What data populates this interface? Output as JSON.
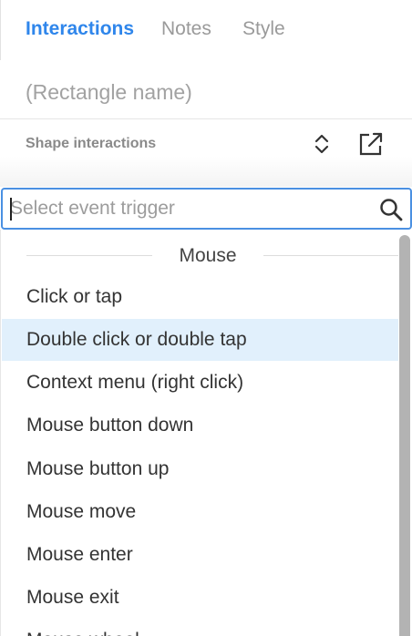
{
  "tabs": [
    {
      "label": "Interactions",
      "active": true
    },
    {
      "label": "Notes",
      "active": false
    },
    {
      "label": "Style",
      "active": false
    }
  ],
  "name_field": {
    "placeholder": "(Rectangle name)"
  },
  "section": {
    "title": "Shape interactions",
    "icons": [
      "expand-collapse-icon",
      "external-link-icon"
    ]
  },
  "search": {
    "placeholder": "Select event trigger",
    "value": "",
    "icon": "search-icon"
  },
  "dropdown": {
    "group_label": "Mouse",
    "items": [
      {
        "label": "Click or tap",
        "highlighted": false
      },
      {
        "label": "Double click or double tap",
        "highlighted": true
      },
      {
        "label": "Context menu (right click)",
        "highlighted": false
      },
      {
        "label": "Mouse button down",
        "highlighted": false
      },
      {
        "label": "Mouse button up",
        "highlighted": false
      },
      {
        "label": "Mouse move",
        "highlighted": false
      },
      {
        "label": "Mouse enter",
        "highlighted": false
      },
      {
        "label": "Mouse exit",
        "highlighted": false
      },
      {
        "label": "Mouse wheel",
        "highlighted": false
      }
    ]
  },
  "colors": {
    "accent": "#2f86eb",
    "focus_border": "#4a90e2",
    "highlight": "#e1f0fc",
    "scrollbar": "#b3b3b3"
  }
}
